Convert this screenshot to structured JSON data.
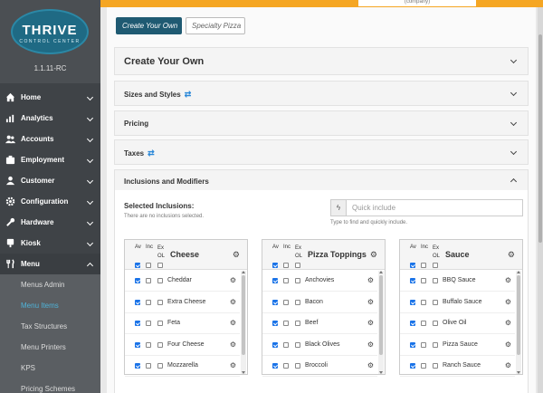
{
  "sidebar": {
    "logo_main": "THRIVE",
    "logo_sub": "CONTROL CENTER",
    "version": "1.1.11-RC",
    "items": [
      {
        "label": "Home",
        "icon": "home-icon"
      },
      {
        "label": "Analytics",
        "icon": "chart-icon"
      },
      {
        "label": "Accounts",
        "icon": "users-icon"
      },
      {
        "label": "Employment",
        "icon": "badge-icon"
      },
      {
        "label": "Customer",
        "icon": "user-icon"
      },
      {
        "label": "Configuration",
        "icon": "gear-icon"
      },
      {
        "label": "Hardware",
        "icon": "wrench-icon"
      },
      {
        "label": "Kiosk",
        "icon": "kiosk-icon"
      },
      {
        "label": "Menu",
        "icon": "fork-knife-icon"
      }
    ],
    "sub_items": [
      "Menus Admin",
      "Menu Items",
      "Tax Structures",
      "Menu Printers",
      "KPS",
      "Pricing Schemes"
    ]
  },
  "topbar": {
    "company": "(company)"
  },
  "tabs": {
    "create_your_own": "Create Your Own",
    "specialty_pizza": "Specialty Pizza"
  },
  "main": {
    "header": "Create Your Own",
    "sections": [
      "Sizes and Styles",
      "Pricing",
      "Taxes",
      "Inclusions and Modifiers"
    ],
    "swap_glyph": "⇄",
    "selected_inclusions_label": "Selected Inclusions:",
    "selected_none": "There are no inclusions selected.",
    "quick_include_placeholder": "Quick include",
    "quick_include_help": "Type to find and quickly include.",
    "col_av": "Av",
    "col_inc": "Inc",
    "col_ex": "Ex",
    "col_ol": "OL",
    "groups": [
      {
        "title": "Cheese",
        "items": [
          "Cheddar",
          "Extra Cheese",
          "Feta",
          "Four Cheese",
          "Mozzarella"
        ]
      },
      {
        "title": "Pizza Toppings",
        "items": [
          "Anchovies",
          "Bacon",
          "Beef",
          "Black Olives",
          "Broccoli"
        ]
      },
      {
        "title": "Sauce",
        "items": [
          "BBQ Sauce",
          "Buffalo Sauce",
          "Olive Oil",
          "Pizza Sauce",
          "Ranch Sauce"
        ]
      }
    ]
  },
  "icons": {
    "gear": "⚙",
    "bolt": "ϟ"
  },
  "colors": {
    "accent": "#1f5a72",
    "topbar": "#f5a623",
    "checkbox": "#1a73e8",
    "active_sub": "#4fb3d9"
  }
}
